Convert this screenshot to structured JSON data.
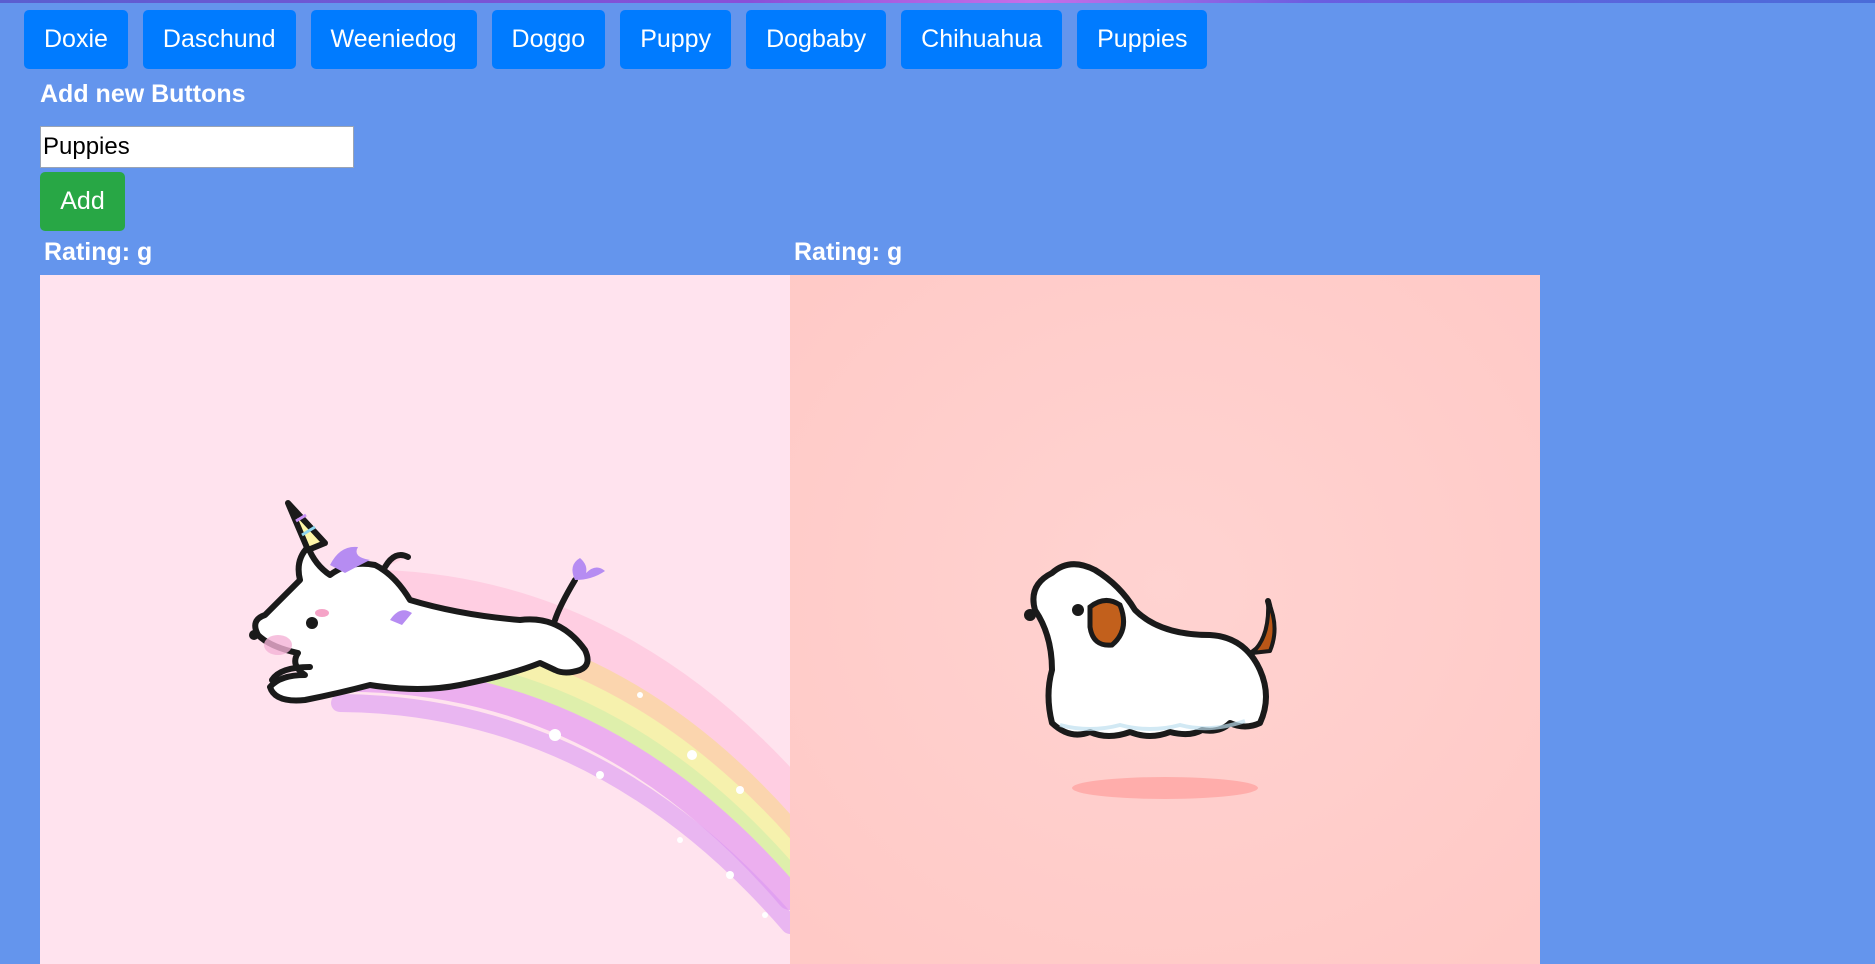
{
  "topic_buttons": [
    "Doxie",
    "Daschund",
    "Weeniedog",
    "Doggo",
    "Puppy",
    "Dogbaby",
    "Chihuahua",
    "Puppies"
  ],
  "add_form": {
    "title": "Add new Buttons",
    "input_value": "Puppies",
    "add_label": "Add"
  },
  "gifs": [
    {
      "rating": "Rating: g",
      "background": "#ffe3ee",
      "subject": "unicorn-dachshund-rainbow"
    },
    {
      "rating": "Rating: g",
      "background": "#ffd0cf",
      "subject": "ghost-dog"
    }
  ],
  "colors": {
    "page_bg": "#6495ed",
    "topic_button": "#007bff",
    "add_button": "#28a745"
  }
}
